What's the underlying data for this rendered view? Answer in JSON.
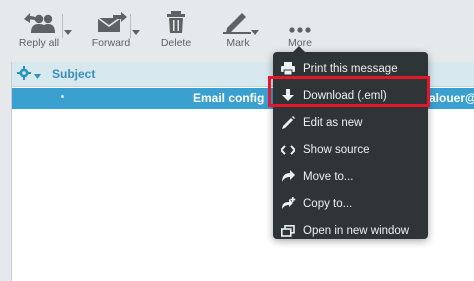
{
  "toolbar": {
    "reply_all": "Reply all",
    "forward": "Forward",
    "delete": "Delete",
    "mark": "Mark",
    "more": "More"
  },
  "list": {
    "subject_header": "Subject",
    "selected_row": {
      "subject": "Email config",
      "from": "alouer@"
    }
  },
  "more_menu": {
    "items": [
      {
        "label": "Print this message",
        "icon": "print-icon"
      },
      {
        "label": "Download (.eml)",
        "icon": "download-icon"
      },
      {
        "label": "Edit as new",
        "icon": "pencil-icon"
      },
      {
        "label": "Show source",
        "icon": "code-icon"
      },
      {
        "label": "Move to...",
        "icon": "move-icon"
      },
      {
        "label": "Copy to...",
        "icon": "copy-icon"
      },
      {
        "label": "Open in new window",
        "icon": "new-window-icon"
      }
    ],
    "highlighted_item": "Download (.eml)"
  },
  "colors": {
    "selection": "#3aa0d0",
    "menu_bg": "#2f3437",
    "highlight_border": "#e2162d",
    "header_bg": "#d8e8ef"
  }
}
